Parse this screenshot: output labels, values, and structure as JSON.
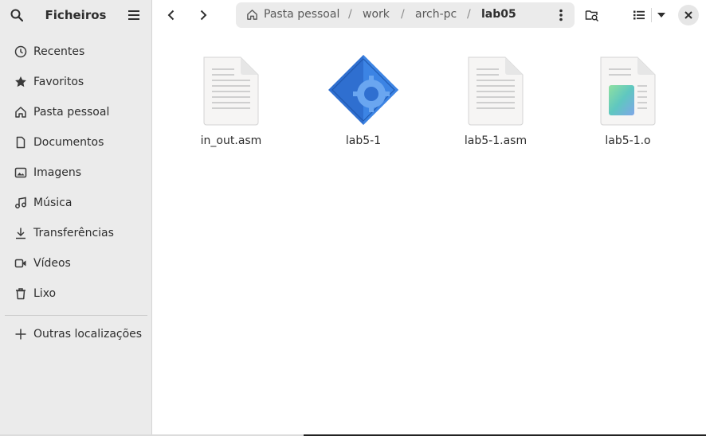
{
  "sidebar": {
    "title": "Ficheiros",
    "items": [
      {
        "label": "Recentes",
        "icon": "clock-icon"
      },
      {
        "label": "Favoritos",
        "icon": "star-icon"
      },
      {
        "label": "Pasta pessoal",
        "icon": "home-icon"
      },
      {
        "label": "Documentos",
        "icon": "document-icon"
      },
      {
        "label": "Imagens",
        "icon": "image-icon"
      },
      {
        "label": "Música",
        "icon": "music-icon"
      },
      {
        "label": "Transferências",
        "icon": "download-icon"
      },
      {
        "label": "Vídeos",
        "icon": "video-icon"
      },
      {
        "label": "Lixo",
        "icon": "trash-icon"
      }
    ],
    "other_locations": {
      "label": "Outras localizações",
      "icon": "plus-icon"
    }
  },
  "path": {
    "home": "Pasta pessoal",
    "separator": "/",
    "segments": [
      "work",
      "arch-pc",
      "lab05"
    ]
  },
  "files": [
    {
      "name": "in_out.asm",
      "type": "text"
    },
    {
      "name": "lab5-1",
      "type": "executable"
    },
    {
      "name": "lab5-1.asm",
      "type": "text"
    },
    {
      "name": "lab5-1.o",
      "type": "object"
    }
  ],
  "colors": {
    "sidebar_bg": "#ebebeb",
    "pathbar_bg": "#ebebeb",
    "text": "#2e2e2e",
    "exec_blue": "#2f6fd0"
  }
}
